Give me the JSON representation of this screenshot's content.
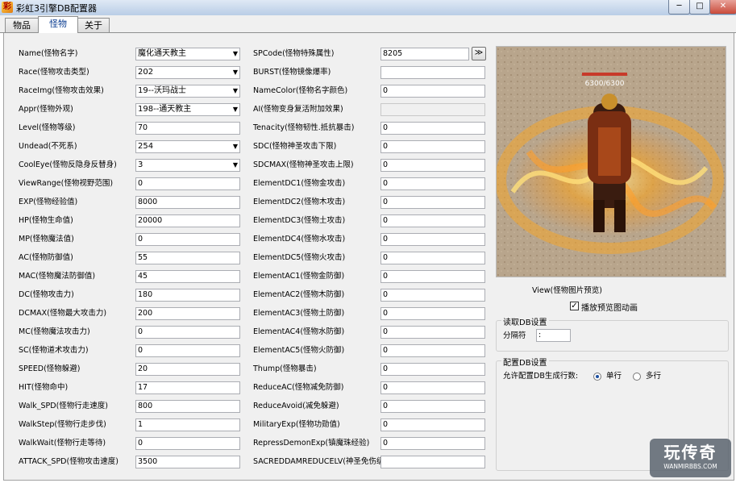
{
  "window": {
    "title": "彩虹3引擎DB配置器",
    "app_icon": "彩",
    "minimize_glyph": "─",
    "maximize_glyph": "□",
    "close_glyph": "✕"
  },
  "tabs": [
    {
      "label": "物品"
    },
    {
      "label": "怪物"
    },
    {
      "label": "关于"
    }
  ],
  "left_fields": [
    {
      "label": "Name(怪物名字)",
      "value": "魔化通天教主",
      "type": "select"
    },
    {
      "label": "Race(怪物攻击类型)",
      "value": "202",
      "type": "select"
    },
    {
      "label": "RaceImg(怪物攻击效果)",
      "value": "19--沃玛战士",
      "type": "select"
    },
    {
      "label": "Appr(怪物外观)",
      "value": "198--通天教主",
      "type": "select"
    },
    {
      "label": "Level(怪物等级)",
      "value": "70",
      "type": "text"
    },
    {
      "label": "Undead(不死系)",
      "value": "254",
      "type": "select"
    },
    {
      "label": "CoolEye(怪物反隐身反替身)",
      "value": "3",
      "type": "select"
    },
    {
      "label": "ViewRange(怪物视野范围)",
      "value": "0",
      "type": "text"
    },
    {
      "label": "EXP(怪物经验值)",
      "value": "8000",
      "type": "text"
    },
    {
      "label": "HP(怪物生命值)",
      "value": "20000",
      "type": "text"
    },
    {
      "label": "MP(怪物魔法值)",
      "value": "0",
      "type": "text"
    },
    {
      "label": "AC(怪物防御值)",
      "value": "55",
      "type": "text"
    },
    {
      "label": "MAC(怪物魔法防御值)",
      "value": "45",
      "type": "text"
    },
    {
      "label": "DC(怪物攻击力)",
      "value": "180",
      "type": "text"
    },
    {
      "label": "DCMAX(怪物最大攻击力)",
      "value": "200",
      "type": "text"
    },
    {
      "label": "MC(怪物魔法攻击力)",
      "value": "0",
      "type": "text"
    },
    {
      "label": "SC(怪物道术攻击力)",
      "value": "0",
      "type": "text"
    },
    {
      "label": "SPEED(怪物躲避)",
      "value": "20",
      "type": "text"
    },
    {
      "label": "HIT(怪物命中)",
      "value": "17",
      "type": "text"
    },
    {
      "label": "Walk_SPD(怪物行走速度)",
      "value": "800",
      "type": "text"
    },
    {
      "label": "WalkStep(怪物行走步伐)",
      "value": "1",
      "type": "text"
    },
    {
      "label": "WalkWait(怪物行走等待)",
      "value": "0",
      "type": "text"
    },
    {
      "label": "ATTACK_SPD(怪物攻击速度)",
      "value": "3500",
      "type": "text"
    }
  ],
  "right_fields": [
    {
      "label": "SPCode(怪物特殊属性)",
      "value": "8205",
      "type": "text"
    },
    {
      "label": "BURST(怪物镜像爆率)",
      "value": "",
      "type": "text"
    },
    {
      "label": "NameColor(怪物名字颜色)",
      "value": "0",
      "type": "text"
    },
    {
      "label": "AI(怪物变身复活附加效果)",
      "value": "",
      "type": "disabled"
    },
    {
      "label": "Tenacity(怪物韧性.抵抗暴击)",
      "value": "0",
      "type": "text"
    },
    {
      "label": "SDC(怪物神圣攻击下限)",
      "value": "0",
      "type": "text"
    },
    {
      "label": "SDCMAX(怪物神圣攻击上限)",
      "value": "0",
      "type": "text"
    },
    {
      "label": "ElementDC1(怪物金攻击)",
      "value": "0",
      "type": "text"
    },
    {
      "label": "ElementDC2(怪物木攻击)",
      "value": "0",
      "type": "text"
    },
    {
      "label": "ElementDC3(怪物土攻击)",
      "value": "0",
      "type": "text"
    },
    {
      "label": "ElementDC4(怪物水攻击)",
      "value": "0",
      "type": "text"
    },
    {
      "label": "ElementDC5(怪物火攻击)",
      "value": "0",
      "type": "text"
    },
    {
      "label": "ElementAC1(怪物金防御)",
      "value": "0",
      "type": "text"
    },
    {
      "label": "ElementAC2(怪物木防御)",
      "value": "0",
      "type": "text"
    },
    {
      "label": "ElementAC3(怪物土防御)",
      "value": "0",
      "type": "text"
    },
    {
      "label": "ElementAC4(怪物水防御)",
      "value": "0",
      "type": "text"
    },
    {
      "label": "ElementAC5(怪物火防御)",
      "value": "0",
      "type": "text"
    },
    {
      "label": "Thump(怪物暴击)",
      "value": "0",
      "type": "text"
    },
    {
      "label": "ReduceAC(怪物减免防御)",
      "value": "0",
      "type": "text"
    },
    {
      "label": "ReduceAvoid(减免躲避)",
      "value": "0",
      "type": "text"
    },
    {
      "label": "MilitaryExp(怪物功勋值)",
      "value": "0",
      "type": "text"
    },
    {
      "label": "RepressDemonExp(镇魔珠经验)",
      "value": "0",
      "type": "text"
    },
    {
      "label": "SACREDDAMREDUCELV(神圣免伤级)",
      "value": "",
      "type": "text"
    }
  ],
  "spcode_button": "≫",
  "preview": {
    "caption": "View(怪物图片预览)",
    "overhead_text": "6300/6300",
    "animate_label": "播放预览图动画",
    "animate_checked": true,
    "check_glyph": "✓"
  },
  "read_group": {
    "title": "读取DB设置",
    "separator_label": "分隔符",
    "separator_value": ":"
  },
  "config_group": {
    "title": "配置DB设置",
    "rows_label": "允许配置DB生成行数:",
    "option_single": "单行",
    "option_multi": "多行",
    "selected": "单行"
  },
  "watermark": {
    "text": "玩传奇",
    "subtext": "WANMIRBBS.COM"
  },
  "colors": {
    "accent": "#0b3d91",
    "flame": "#f28a1a"
  }
}
